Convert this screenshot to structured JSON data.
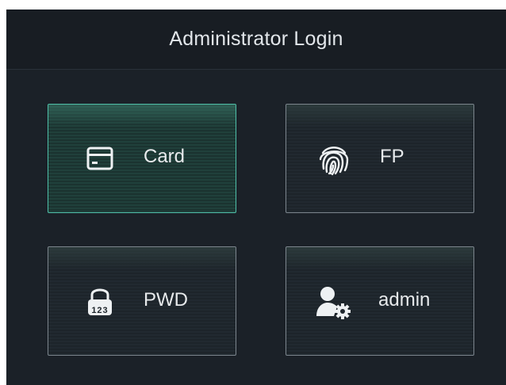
{
  "header": {
    "title": "Administrator Login"
  },
  "options": {
    "card": {
      "label": "Card",
      "icon": "card-icon",
      "selected": true
    },
    "fp": {
      "label": "FP",
      "icon": "fingerprint-icon",
      "selected": false
    },
    "pwd": {
      "label": "PWD",
      "icon": "padlock-123-icon",
      "icon_text": "123",
      "selected": false
    },
    "admin": {
      "label": "admin",
      "icon": "user-gear-icon",
      "selected": false
    }
  },
  "colors": {
    "background": "#1b2128",
    "title_bar": "#181d23",
    "selected_border": "#4fbfa8",
    "tile_border": "#7c858d",
    "text": "#e7eaec"
  }
}
